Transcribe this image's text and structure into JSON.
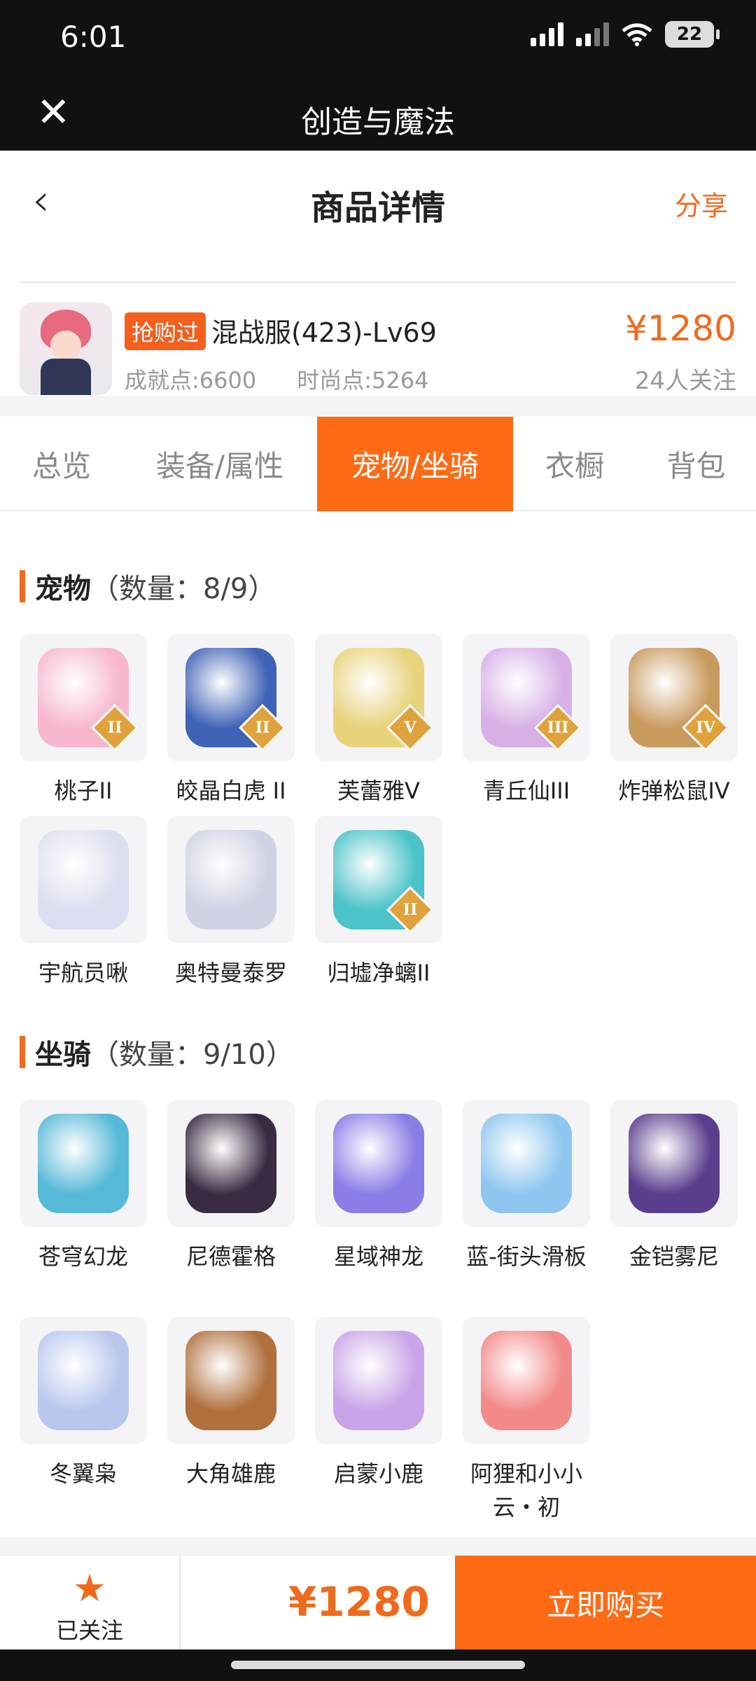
{
  "status": {
    "time": "6:01",
    "battery": "22"
  },
  "appbar": {
    "title": "创造与魔法"
  },
  "header": {
    "title": "商品详情",
    "share": "分享"
  },
  "product": {
    "tag": "抢购过",
    "name": "混战服(423)-Lv69",
    "achievement": "成就点:6600",
    "fashion": "时尚点:5264",
    "price": "¥1280",
    "followers": "24人关注"
  },
  "tabs": [
    "总览",
    "装备/属性",
    "宠物/坐骑",
    "衣橱",
    "背包"
  ],
  "active_tab": "宠物/坐骑",
  "pets": {
    "title": "宠物",
    "count": "（数量：8/9）",
    "items": [
      {
        "name": "桃子II",
        "grade": "II",
        "color": "#f7b7cf"
      },
      {
        "name": "皎晶白虎 II",
        "grade": "II",
        "color": "#3f63b5"
      },
      {
        "name": "芙蕾雅V",
        "grade": "V",
        "color": "#e8d27a"
      },
      {
        "name": "青丘仙III",
        "grade": "III",
        "color": "#d7b0e6"
      },
      {
        "name": "炸弹松鼠IV",
        "grade": "IV",
        "color": "#c99a5e"
      },
      {
        "name": "宇航员啾",
        "grade": "",
        "color": "#dcdff0"
      },
      {
        "name": "奥特曼泰罗",
        "grade": "",
        "color": "#cfd3e3"
      },
      {
        "name": "归墟净螭II",
        "grade": "II",
        "color": "#4cc3c9"
      }
    ]
  },
  "mounts": {
    "title": "坐骑",
    "count": "（数量：9/10）",
    "items": [
      {
        "name": "苍穹幻龙",
        "color": "#56b9d8"
      },
      {
        "name": "尼德霍格",
        "color": "#3a2b43"
      },
      {
        "name": "星域神龙",
        "color": "#8a7ee6"
      },
      {
        "name": "蓝-街头滑板",
        "color": "#8ec6ef"
      },
      {
        "name": "金铠雾尼",
        "color": "#5a3d8c"
      },
      {
        "name": "冬翼枭",
        "color": "#b9c7ee"
      },
      {
        "name": "大角雄鹿",
        "color": "#b0703d"
      },
      {
        "name": "启蒙小鹿",
        "color": "#c9a4e8"
      },
      {
        "name": "阿狸和小小云・初",
        "color": "#f28a8a"
      }
    ]
  },
  "bottom": {
    "follow_label": "已关注",
    "price": "¥1280",
    "buy": "立即购买"
  },
  "colors": {
    "accent": "#ff6a14",
    "price": "#f06a1c"
  }
}
